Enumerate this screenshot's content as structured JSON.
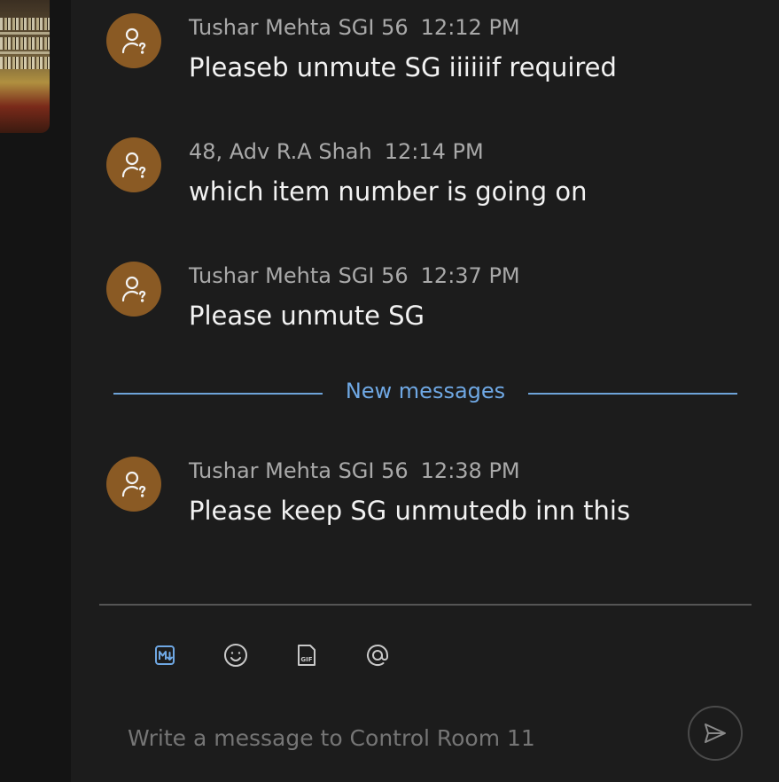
{
  "messages": [
    {
      "author": "Tushar Mehta SGI 56",
      "time": "12:12 PM",
      "text": "Pleaseb unmute SG iiiiiif required"
    },
    {
      "author": "48, Adv R.A Shah",
      "time": "12:14 PM",
      "text": "which item number is going on"
    },
    {
      "author": "Tushar Mehta SGI 56",
      "time": "12:37 PM",
      "text": "Please unmute SG"
    },
    {
      "author": "Tushar Mehta SGI 56",
      "time": "12:38 PM",
      "text": "Please keep SG unmutedb inn this"
    }
  ],
  "divider": {
    "label": "New messages"
  },
  "composer": {
    "placeholder": "Write a message to Control Room 11",
    "toolbar": [
      {
        "icon": "markdown-icon",
        "active": true
      },
      {
        "icon": "emoji-icon"
      },
      {
        "icon": "gif-icon",
        "label": "GIF"
      },
      {
        "icon": "mention-icon"
      }
    ],
    "send_icon": "send-icon"
  },
  "colors": {
    "background": "#1c1c1c",
    "avatar": "#8a5a24",
    "accent": "#6fa8e4",
    "meta_text": "#a9a9a9",
    "message_text": "#f2f2f2"
  }
}
